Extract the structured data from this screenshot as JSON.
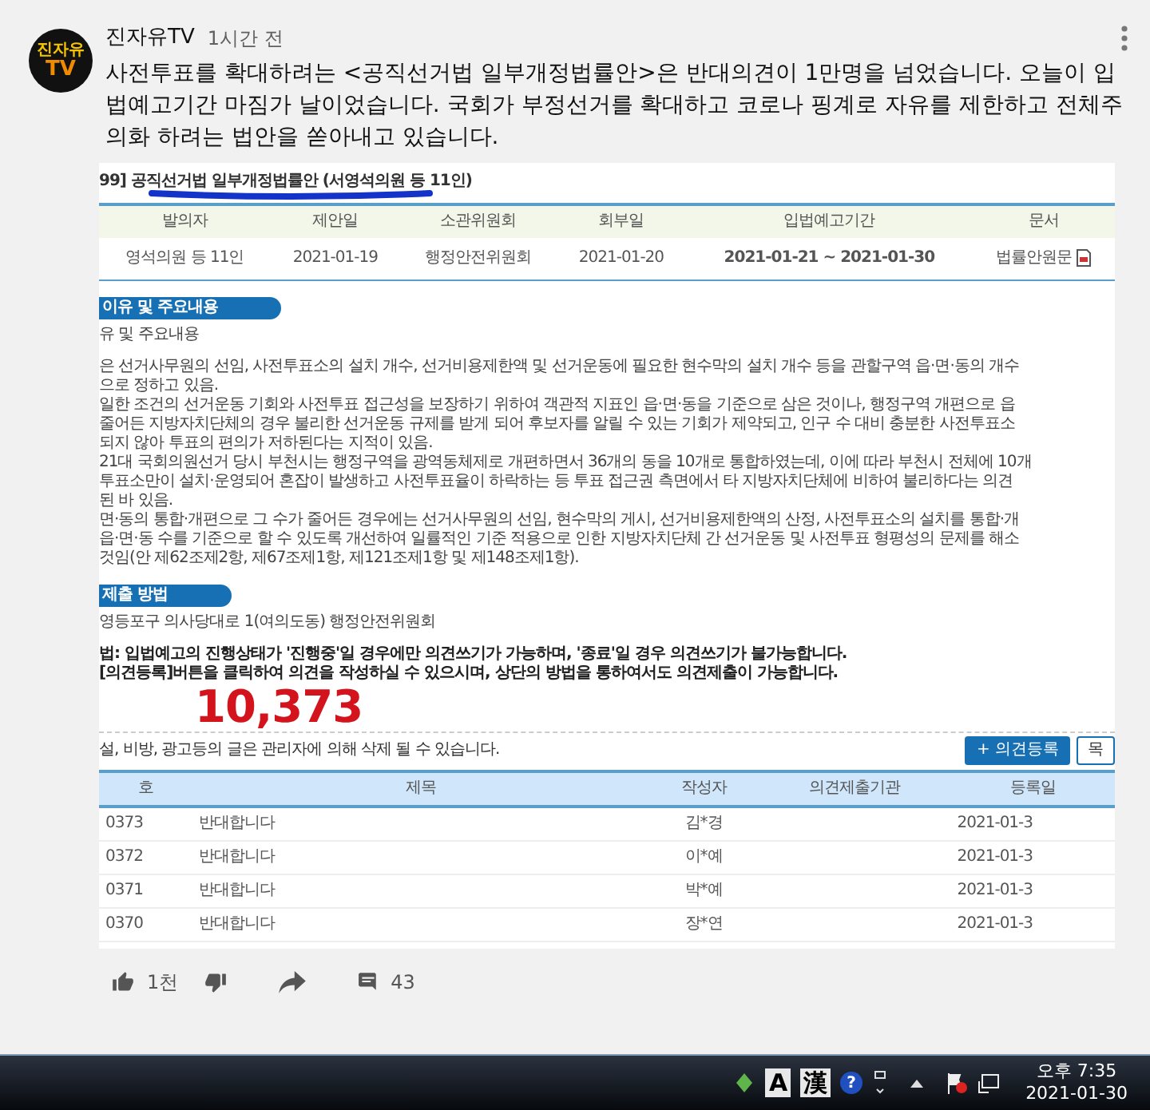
{
  "post": {
    "avatar": {
      "line_1": "진자유",
      "line_2": "TV"
    },
    "channel": "진자유TV",
    "time": "1시간 전",
    "text": "사전투표를 확대하려는 <공직선거법 일부개정법률안>은 반대의견이 1만명을 넘었습니다. 오늘이 입법예고기간 마짐가 날이었습니다. 국회가 부정선거를 확대하고 코로나 핑계로 자유를 제한하고 전체주의화 하려는 법안을 쏟아내고 있습니다."
  },
  "document": {
    "title": "99] 공직선거법 일부개정법률안 (서영석의원 등 11인)",
    "info_table": {
      "columns": [
        "발의자",
        "제안일",
        "소관위원회",
        "회부일",
        "입법예고기간",
        "문서"
      ],
      "row": [
        "영석의원 등 11인",
        "2021-01-19",
        "행정안전위원회",
        "2021-01-20",
        "2021-01-21 ~ 2021-01-30",
        "법률안원문"
      ]
    },
    "reason_section": {
      "heading": "이유 및 주요내용",
      "subheading": "유 및 주요내용",
      "lines": [
        "은 선거사무원의 선임, 사전투표소의 설치 개수, 선거비용제한액 및 선거운동에 필요한 현수막의 설치 개수 등을 관할구역 읍·면·동의 개수",
        "으로 정하고 있음.",
        "일한 조건의 선거운동 기회와 사전투표 접근성을 보장하기 위하여 객관적 지표인 읍·면·동을 기준으로 삼은 것이나, 행정구역 개편으로 읍",
        "줄어든 지방자치단체의 경우 불리한 선거운동 규제를 받게 되어 후보자를 알릴 수 있는 기회가 제약되고, 인구 수 대비 충분한 사전투표소",
        "되지 않아 투표의 편의가 저하된다는 지적이 있음.",
        "21대 국회의원선거 당시 부천시는 행정구역을 광역동체제로 개편하면서 36개의 동을 10개로 통합하였는데, 이에 따라 부천시 전체에 10개",
        "투표소만이 설치·운영되어 혼잡이 발생하고 사전투표율이 하락하는 등 투표 접근권 측면에서 타 지방자치단체에 비하여 불리하다는 의견",
        "된 바 있음.",
        "면·동의 통합·개편으로 그 수가 줄어든 경우에는 선거사무원의 선임, 현수막의 게시, 선거비용제한액의 산정, 사전투표소의 설치를 통합·개",
        "읍·면·동 수를 기준으로 할 수 있도록 개선하여 일률적인 기준 적용으로 인한 지방자치단체 간 선거운동 및 사전투표 형평성의 문제를 해소",
        "것임(안 제62조제2항, 제67조제1항, 제121조제1항 및 제148조제1항)."
      ]
    },
    "submit_section": {
      "heading": "제출 방법",
      "address": "영등포구 의사당대로 1(여의도동) 행정안전위원회",
      "notes": [
        "법: 입법예고의 진행상태가 '진행중'일 경우에만 의견쓰기가 가능하며, '종료'일 경우 의견쓰기가 불가능합니다.",
        "[의견등록]버튼을 클릭하여 의견을 작성하실 수 있으시며, 상단의 방법을 통하여서도 의견제출이 가능합니다."
      ]
    },
    "handwritten_count": "10,373",
    "notice": "설, 비방, 광고등의 글은 관리자에 의해 삭제 될 수 있습니다.",
    "buttons": [
      "+ 의견등록",
      "목"
    ],
    "opinion_table": {
      "columns": [
        "호",
        "제목",
        "작성자",
        "의견제출기관",
        "등록일"
      ],
      "rows": [
        [
          "0373",
          "반대합니다",
          "김*경",
          "",
          "2021-01-3"
        ],
        [
          "0372",
          "반대합니다",
          "이*예",
          "",
          "2021-01-3"
        ],
        [
          "0371",
          "반대합니다",
          "박*예",
          "",
          "2021-01-3"
        ],
        [
          "0370",
          "반대합니다",
          "장*연",
          "",
          "2021-01-3"
        ]
      ]
    }
  },
  "actions": {
    "likes": "1천",
    "comments": "43"
  },
  "taskbar": {
    "ime_mode": "A",
    "ime_hanja": "漢",
    "help": "?",
    "time": "오후 7:35",
    "date": "2021-01-30"
  }
}
